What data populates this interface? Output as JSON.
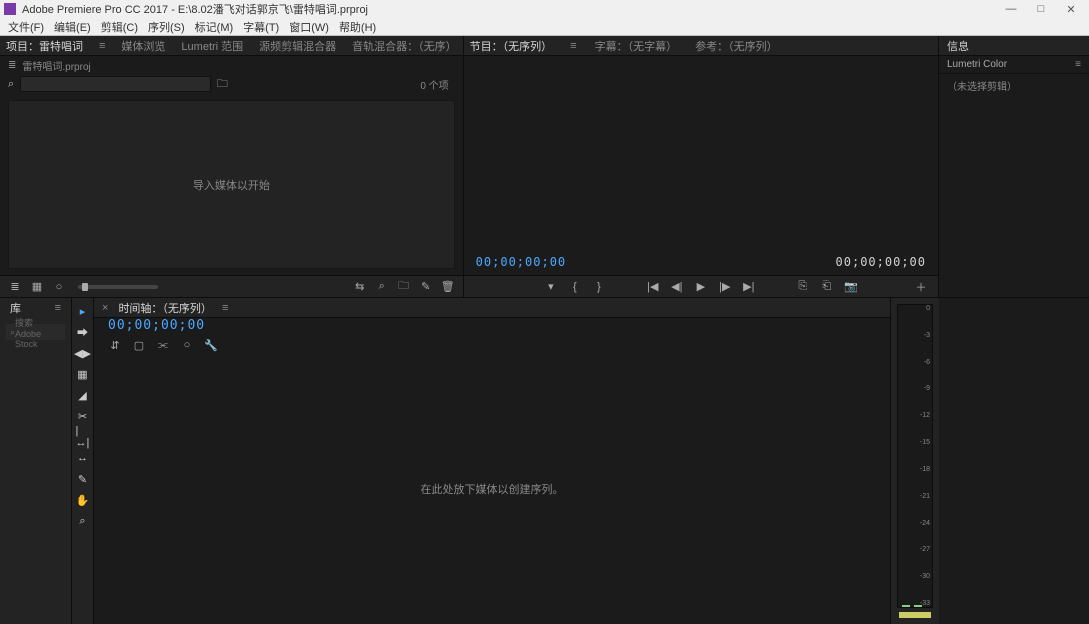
{
  "app": {
    "title": "Adobe Premiere Pro CC 2017 - E:\\8.02潘飞对话郭京飞\\雷特唱词.prproj"
  },
  "menu": {
    "file": "文件(F)",
    "edit": "编辑(E)",
    "clip": "剪辑(C)",
    "sequence": "序列(S)",
    "marker": "标记(M)",
    "subtitle": "字幕(T)",
    "window": "窗口(W)",
    "help": "帮助(H)"
  },
  "project": {
    "tab_project": "项目：雷特唱词",
    "tab_media": "媒体浏览",
    "tab_lumetri": "Lumetri 范围",
    "tab_sourcemon": "源频剪辑混合器",
    "tab_audiomix": "音轨混合器：（无序）",
    "crumb_icon": "≣",
    "crumb_text": "雷特唱词.prproj",
    "search_placeholder": "",
    "search_icon": "⌕",
    "item_count": "0 个项",
    "importmsg": "导入媒体以开始",
    "footer": {
      "list": "≣",
      "thumb": "▦",
      "freeform": "○",
      "drag": "⇆",
      "item": "✎",
      "folder": "🗀",
      "trash": "🗑",
      "search": "⌕"
    }
  },
  "program": {
    "tab_program": "节目：（无序列）",
    "tab_subtitle": "字幕：（无字幕）",
    "tab_reference": "参考：（无序列）",
    "tc_left": "00;00;00;00",
    "tc_right": "00;00;00;00",
    "transport": {
      "mark": "▾",
      "in": "{",
      "out": "}",
      "gostart": "|◀",
      "stepback": "◀|",
      "play": "▶",
      "stepfwd": "|▶",
      "goend": "▶|",
      "lift": "⎘",
      "extract": "⎗",
      "export": "📷",
      "plus": "＋"
    }
  },
  "side": {
    "title_info": "信息",
    "title_lumetri": "Lumetri Color",
    "noclip": "（未选择剪辑）"
  },
  "lib": {
    "tab": "库",
    "search_ph": "搜索 Adobe Stock"
  },
  "tools": {
    "selection": "▸",
    "trackselect": "⮕",
    "ripple": "◀▶",
    "rolling": "▦",
    "rate": "◢",
    "razor": "✂",
    "slip": "|↔|",
    "slide": "↔",
    "pen": "✎",
    "hand": "✋",
    "zoom": "⌕"
  },
  "timeline": {
    "tab": "时间轴：（无序列）",
    "tc": "00;00;00;00",
    "btns": {
      "snap": "⇵",
      "marker": "▢",
      "linked": "⫘",
      "settings": "○",
      "wrench": "🔧"
    },
    "dropmsg": "在此处放下媒体以创建序列。"
  },
  "meters": {
    "scale": [
      "0",
      "-3",
      "-6",
      "-9",
      "-12",
      "-15",
      "-18",
      "-21",
      "-24",
      "-27",
      "-30",
      "-33"
    ]
  }
}
